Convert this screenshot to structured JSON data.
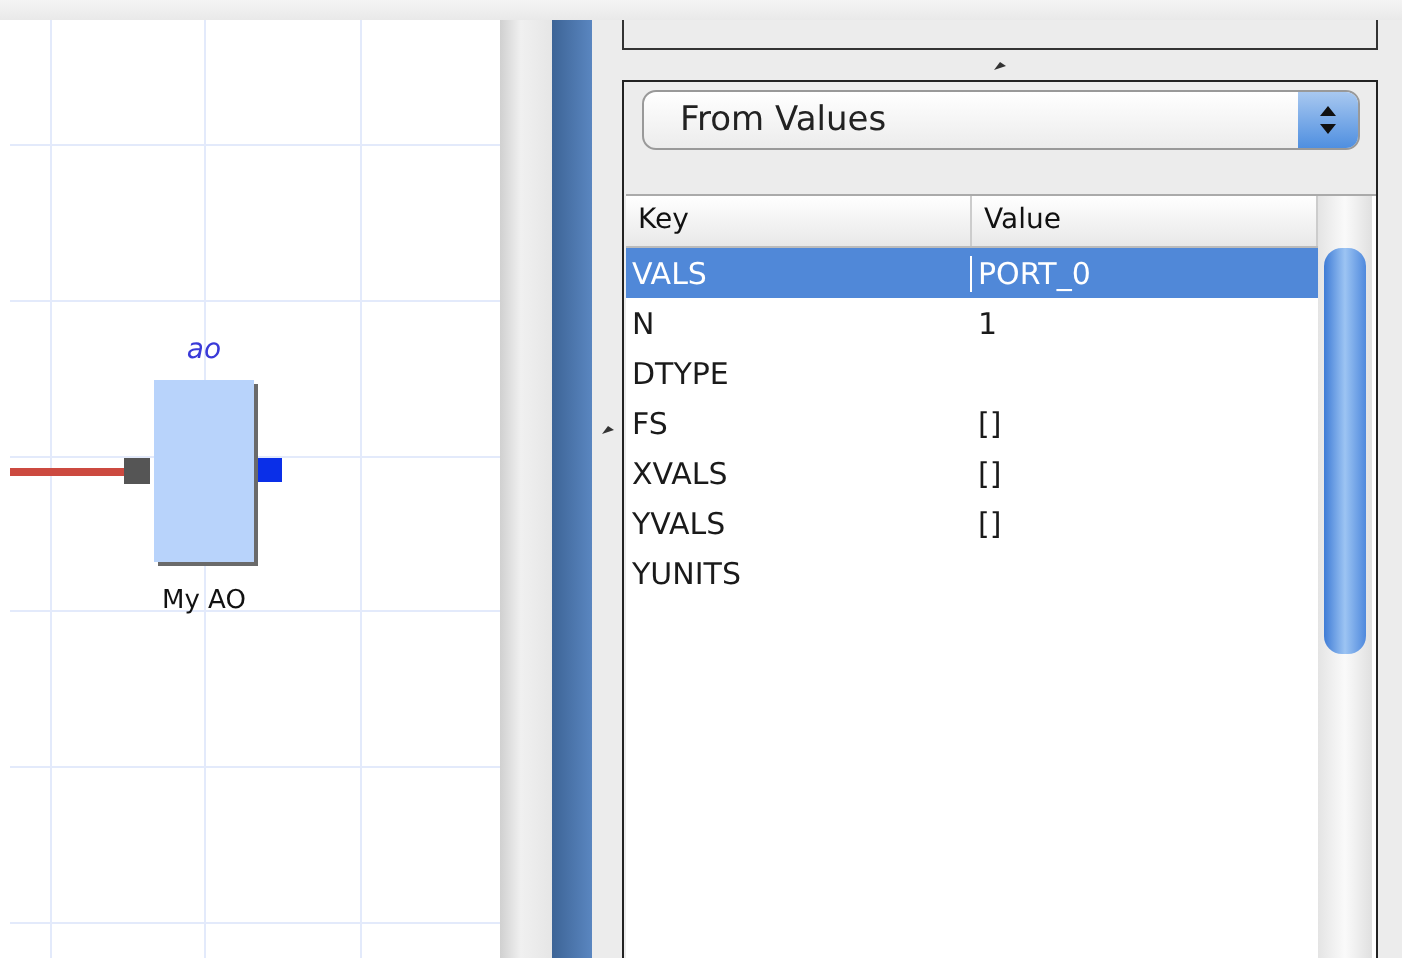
{
  "canvas": {
    "nodes": [
      {
        "title": "ao",
        "label": "My AO",
        "input_connected": true
      }
    ]
  },
  "inspector": {
    "dropdown": {
      "value": "From Values"
    },
    "table": {
      "columns": [
        "Key",
        "Value"
      ],
      "rows": [
        {
          "key": "VALS",
          "value": "PORT_0",
          "selected": true
        },
        {
          "key": "N",
          "value": "1",
          "selected": false
        },
        {
          "key": "DTYPE",
          "selected": false
        },
        {
          "key": "FS",
          "value": "[]",
          "selected": false
        },
        {
          "key": "XVALS",
          "value": "[]",
          "selected": false
        },
        {
          "key": "YVALS",
          "value": "[]",
          "selected": false
        },
        {
          "key": "YUNITS",
          "selected": false
        }
      ]
    }
  }
}
